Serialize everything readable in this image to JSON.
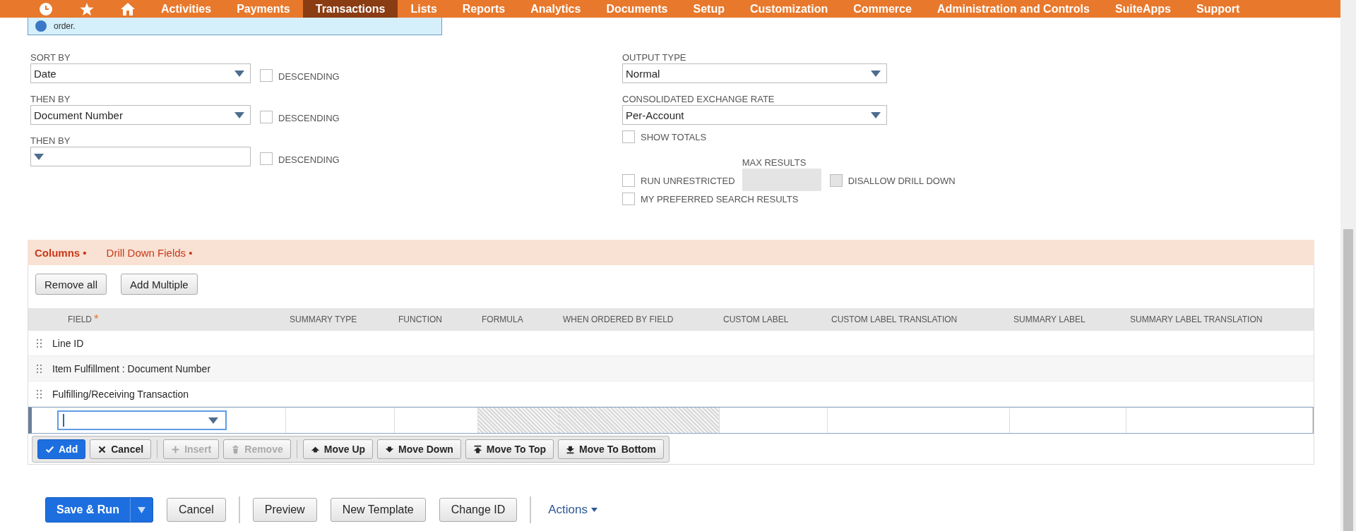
{
  "nav": {
    "items": [
      {
        "label": "Activities",
        "selected": false
      },
      {
        "label": "Payments",
        "selected": false
      },
      {
        "label": "Transactions",
        "selected": true
      },
      {
        "label": "Lists",
        "selected": false
      },
      {
        "label": "Reports",
        "selected": false
      },
      {
        "label": "Analytics",
        "selected": false
      },
      {
        "label": "Documents",
        "selected": false
      },
      {
        "label": "Setup",
        "selected": false
      },
      {
        "label": "Customization",
        "selected": false
      },
      {
        "label": "Commerce",
        "selected": false
      },
      {
        "label": "Administration and Controls",
        "selected": false
      },
      {
        "label": "SuiteApps",
        "selected": false
      },
      {
        "label": "Support",
        "selected": false
      }
    ]
  },
  "notice": {
    "text": "order."
  },
  "sort": [
    {
      "label": "SORT BY",
      "value": "Date",
      "descending": {
        "label": "DESCENDING",
        "checked": false
      }
    },
    {
      "label": "THEN BY",
      "value": "Document Number",
      "descending": {
        "label": "DESCENDING",
        "checked": false
      }
    },
    {
      "label": "THEN BY",
      "descending": {
        "label": "DESCENDING",
        "checked": false
      }
    }
  ],
  "output": {
    "output_type": {
      "label": "OUTPUT TYPE",
      "value": "Normal"
    },
    "exchange_rate": {
      "label": "CONSOLIDATED EXCHANGE RATE",
      "value": "Per-Account"
    },
    "show_totals": {
      "label": "SHOW TOTALS",
      "checked": false
    },
    "run_unrestricted": {
      "label": "RUN UNRESTRICTED",
      "checked": false
    },
    "max_results": {
      "label": "MAX RESULTS",
      "disabled": true
    },
    "disallow_drill_down": {
      "label": "DISALLOW DRILL DOWN",
      "checked": false,
      "disabled": true
    },
    "preferred_results": {
      "label": "MY PREFERRED SEARCH RESULTS",
      "checked": false
    }
  },
  "tabs": [
    {
      "label": "Columns •",
      "selected": true
    },
    {
      "label": "Drill Down Fields •",
      "selected": false
    }
  ],
  "subtab_buttons": [
    "Remove all",
    "Add Multiple"
  ],
  "table": {
    "columns": [
      {
        "label": "FIELD",
        "required_mark": "*",
        "editor_disabled": false
      },
      {
        "label": "SUMMARY TYPE",
        "editor_disabled": false
      },
      {
        "label": "FUNCTION",
        "editor_disabled": false
      },
      {
        "label": "FORMULA",
        "editor_disabled": true
      },
      {
        "label": "WHEN ORDERED BY FIELD",
        "editor_disabled": true
      },
      {
        "label": "CUSTOM LABEL",
        "editor_disabled": false
      },
      {
        "label": "CUSTOM LABEL TRANSLATION",
        "editor_disabled": false
      },
      {
        "label": "SUMMARY LABEL",
        "editor_disabled": false
      },
      {
        "label": "SUMMARY LABEL TRANSLATION",
        "editor_disabled": false
      }
    ],
    "rows": [
      {
        "field": "Line ID"
      },
      {
        "field": "Item Fulfillment : Document Number"
      },
      {
        "field": "Fulfilling/Receiving Transaction"
      }
    ]
  },
  "editor_button_groups": [
    [
      {
        "label": "Add",
        "primary": true,
        "disabled": false
      },
      {
        "label": "Cancel",
        "primary": false,
        "disabled": false
      }
    ],
    [
      {
        "label": "Insert",
        "primary": false,
        "disabled": true
      },
      {
        "label": "Remove",
        "primary": false,
        "disabled": true
      }
    ],
    [
      {
        "label": "Move Up",
        "primary": false,
        "disabled": false
      },
      {
        "label": "Move Down",
        "primary": false,
        "disabled": false
      },
      {
        "label": "Move To Top",
        "primary": false,
        "disabled": false
      },
      {
        "label": "Move To Bottom",
        "primary": false,
        "disabled": false
      }
    ]
  ],
  "footer_groups": [
    [
      {
        "label": "Save & Run",
        "kind": "split"
      },
      {
        "label": "Cancel",
        "kind": "button"
      }
    ],
    [
      {
        "label": "Preview",
        "kind": "button"
      },
      {
        "label": "New Template",
        "kind": "button"
      },
      {
        "label": "Change ID",
        "kind": "button"
      }
    ],
    [
      {
        "label": "Actions",
        "kind": "menu"
      }
    ]
  ]
}
